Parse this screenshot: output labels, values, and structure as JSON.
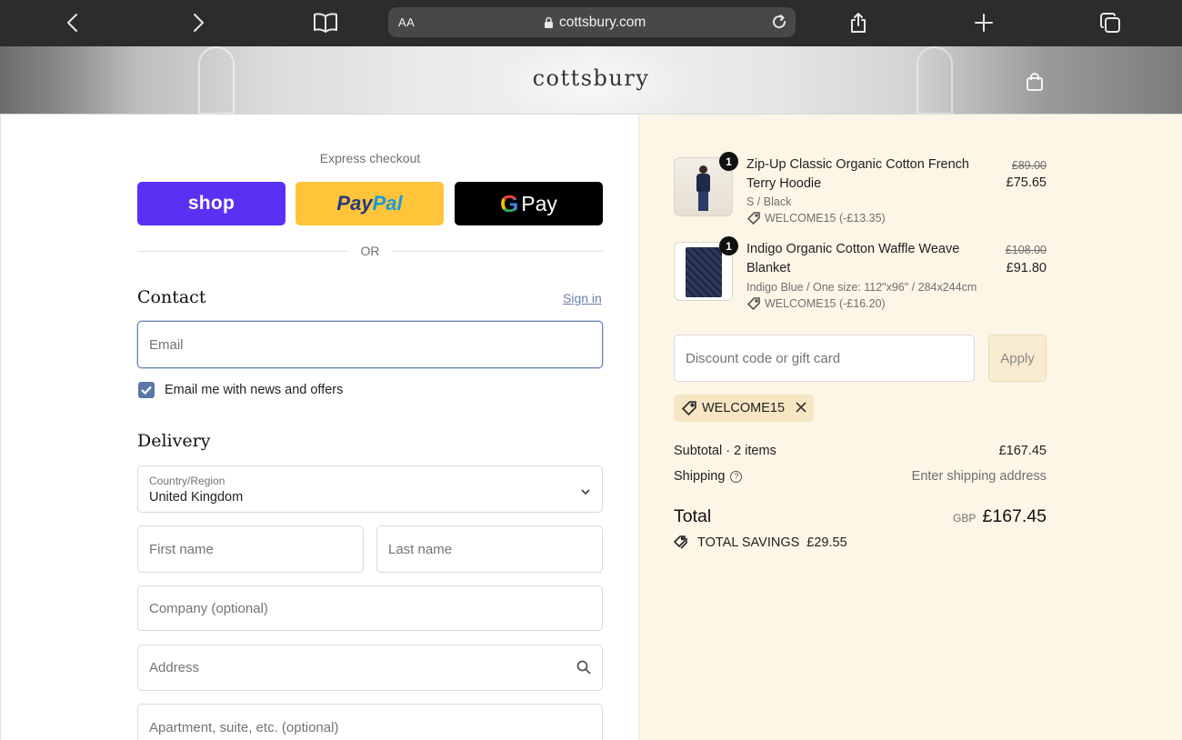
{
  "browser": {
    "text_size_label": "AA",
    "url": "cottsbury.com"
  },
  "site": {
    "brand": "cottsbury"
  },
  "express": {
    "title": "Express checkout",
    "shop_label": "shop",
    "paypal_label_1": "Pay",
    "paypal_label_2": "Pal",
    "gpay_g": "G",
    "gpay_label": "Pay",
    "or_label": "OR"
  },
  "contact": {
    "title": "Contact",
    "sign_in": "Sign in",
    "email_placeholder": "Email",
    "email_value": "",
    "newsletter_label": "Email me with news and offers",
    "newsletter_checked": true
  },
  "delivery": {
    "title": "Delivery",
    "country_label": "Country/Region",
    "country_value": "United Kingdom",
    "first_name_placeholder": "First name",
    "last_name_placeholder": "Last name",
    "company_placeholder": "Company (optional)",
    "address_placeholder": "Address",
    "apartment_placeholder": "Apartment, suite, etc. (optional)"
  },
  "cart": {
    "items": [
      {
        "name": "Zip-Up Classic Organic Cotton French Terry Hoodie",
        "variant": "S / Black",
        "discount": "WELCOME15 (-£13.35)",
        "quantity": "1",
        "original_price": "£89.00",
        "price": "£75.65"
      },
      {
        "name": "Indigo Organic Cotton Waffle Weave Blanket",
        "variant": "Indigo Blue / One size: 112\"x96\" / 284x244cm",
        "discount": "WELCOME15 (-£16.20)",
        "quantity": "1",
        "original_price": "£108.00",
        "price": "£91.80"
      }
    ],
    "discount_placeholder": "Discount code or gift card",
    "apply_label": "Apply",
    "applied_code": "WELCOME15",
    "subtotal_label": "Subtotal · 2 items",
    "subtotal_value": "£167.45",
    "shipping_label": "Shipping",
    "shipping_value": "Enter shipping address",
    "total_label": "Total",
    "total_currency": "GBP",
    "total_value": "£167.45",
    "savings_label": "TOTAL SAVINGS",
    "savings_value": "£29.55"
  },
  "colors": {
    "shop_pay": "#5a31f4",
    "paypal": "#ffc439",
    "gpay": "#000000",
    "summary_bg": "#fdf5e6",
    "checkbox": "#5e77aa"
  }
}
